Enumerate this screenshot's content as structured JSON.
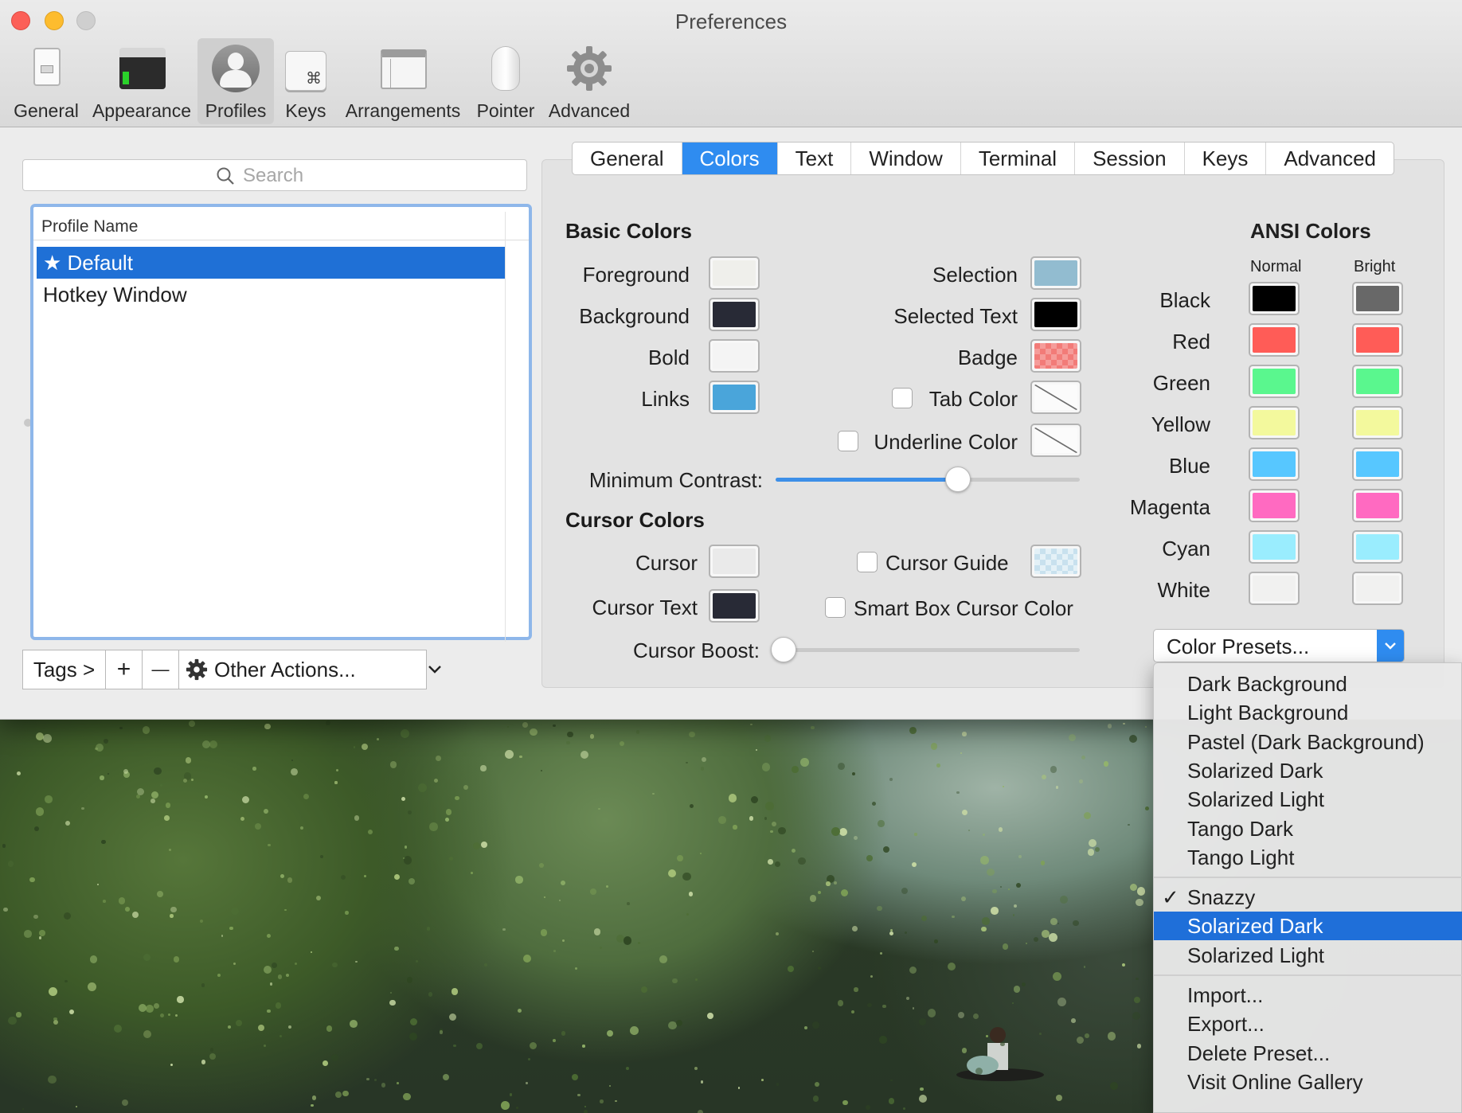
{
  "window": {
    "title": "Preferences"
  },
  "toolbar": {
    "items": [
      {
        "label": "General",
        "icon": "switch-icon"
      },
      {
        "label": "Appearance",
        "icon": "terminal-window-icon"
      },
      {
        "label": "Profiles",
        "icon": "person-icon"
      },
      {
        "label": "Keys",
        "icon": "command-key-icon"
      },
      {
        "label": "Arrangements",
        "icon": "windows-icon"
      },
      {
        "label": "Pointer",
        "icon": "mouse-icon"
      },
      {
        "label": "Advanced",
        "icon": "gear-icon"
      }
    ],
    "selected": "Profiles"
  },
  "profiles": {
    "search_placeholder": "Search",
    "column_header": "Profile Name",
    "items": [
      {
        "label": "★ Default",
        "selected": true
      },
      {
        "label": "Hotkey Window",
        "selected": false
      }
    ],
    "footer": {
      "tags": "Tags >",
      "add": "+",
      "remove": "—",
      "other_actions": "Other Actions..."
    }
  },
  "tabs": {
    "items": [
      "General",
      "Colors",
      "Text",
      "Window",
      "Terminal",
      "Session",
      "Keys",
      "Advanced"
    ],
    "selected": "Colors"
  },
  "basic_colors": {
    "heading": "Basic Colors",
    "left": [
      {
        "label": "Foreground",
        "color": "#efefeb"
      },
      {
        "label": "Background",
        "color": "#282a36"
      },
      {
        "label": "Bold",
        "color": "#f4f4f4"
      },
      {
        "label": "Links",
        "color": "#4aa5da"
      }
    ],
    "right": {
      "selection": {
        "label": "Selection",
        "color": "#92bcd0"
      },
      "selected_text": {
        "label": "Selected Text",
        "color": "#000000"
      },
      "badge": {
        "label": "Badge",
        "color": "#f27b78"
      },
      "tab_color": {
        "label": "Tab Color",
        "checked": false
      },
      "underline_color": {
        "label": "Underline Color",
        "checked": false
      }
    },
    "min_contrast": {
      "label": "Minimum Contrast:",
      "value": 0.6
    }
  },
  "cursor_colors": {
    "heading": "Cursor Colors",
    "cursor": {
      "label": "Cursor",
      "color": "#eaeaea"
    },
    "cursor_text": {
      "label": "Cursor Text",
      "color": "#282a36"
    },
    "cursor_guide": {
      "label": "Cursor Guide",
      "checked": false
    },
    "smart_box": {
      "label": "Smart Box Cursor Color",
      "checked": false
    },
    "cursor_boost": {
      "label": "Cursor Boost:",
      "value": 0.0
    }
  },
  "ansi": {
    "heading": "ANSI Colors",
    "normal_label": "Normal",
    "bright_label": "Bright",
    "rows": [
      {
        "label": "Black",
        "normal": "#000000",
        "bright": "#686868"
      },
      {
        "label": "Red",
        "normal": "#ff5c57",
        "bright": "#ff5c57"
      },
      {
        "label": "Green",
        "normal": "#5af78e",
        "bright": "#5af78e"
      },
      {
        "label": "Yellow",
        "normal": "#f3f99d",
        "bright": "#f3f99d"
      },
      {
        "label": "Blue",
        "normal": "#57c7ff",
        "bright": "#57c7ff"
      },
      {
        "label": "Magenta",
        "normal": "#ff6ac1",
        "bright": "#ff6ac1"
      },
      {
        "label": "Cyan",
        "normal": "#9aedfe",
        "bright": "#9aedfe"
      },
      {
        "label": "White",
        "normal": "#f1f1f0",
        "bright": "#f1f1f0"
      }
    ]
  },
  "presets": {
    "button_label": "Color Presets...",
    "builtin": [
      "Dark Background",
      "Light Background",
      "Pastel (Dark Background)",
      "Solarized Dark",
      "Solarized Light",
      "Tango Dark",
      "Tango Light"
    ],
    "custom": [
      {
        "label": "Snazzy",
        "checked": true,
        "highlighted": false
      },
      {
        "label": "Solarized Dark",
        "checked": false,
        "highlighted": true
      },
      {
        "label": "Solarized Light",
        "checked": false,
        "highlighted": false
      }
    ],
    "actions": [
      "Import...",
      "Export...",
      "Delete Preset...",
      "Visit Online Gallery"
    ],
    "checkmark": "✓"
  },
  "colors": {
    "accent": "#2f8cf0",
    "selection_blue": "#1f70d6"
  }
}
